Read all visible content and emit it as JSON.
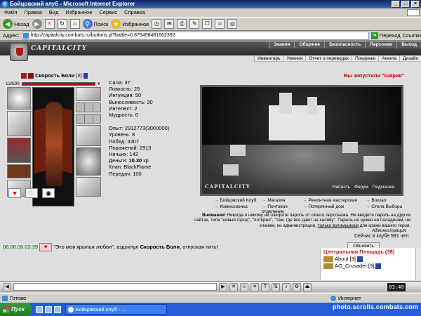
{
  "window": {
    "title": "Бойцовский клуб - Microsoft Internet Explorer"
  },
  "menu": [
    "Файл",
    "Правка",
    "Вид",
    "Избранное",
    "Сервис",
    "Справка"
  ],
  "toolbar": {
    "back": "Назад",
    "search": "Поиск",
    "favorites": "Избранное"
  },
  "address": {
    "label": "Адрес:",
    "url": "http://capitalcity.combats.ru/buttons.pl?battle=0.876498481662392",
    "go": "Переход",
    "links": "Ссылки"
  },
  "site": {
    "logo": "CAPITALCITY",
    "nav": [
      "Знания",
      "Общение",
      "Безопасность",
      "Персонаж",
      "Выход"
    ],
    "subnav": [
      "Инвентарь",
      "Умения",
      "Отчет о переводах",
      "Поединки",
      "Анкета",
      "Дизайн"
    ]
  },
  "character": {
    "name": "Скорость Боли",
    "level": "[8]",
    "hp": "13/599",
    "stats": [
      "Сила: 37",
      "Ловкость: 25",
      "Интуиция: 50",
      "Выносливость: 30",
      "Интелект: 2",
      "Мудрость: 0"
    ],
    "info": [
      "Опыт: 2912773(3000000)",
      "Уровень: 8",
      "Побед: 3307",
      "Поражений: 2913",
      "Ничьих: 142"
    ],
    "money_label": "Деньги: ",
    "money_value": "10.30",
    "money_unit": " кр.",
    "clan": "Клан: BlackFlame",
    "transfers": "Передач: 100"
  },
  "notice": "Вы запустили \"Шарик\"",
  "scene": {
    "title": "CAPITALCITY",
    "links": [
      "Напасть",
      "Форум",
      "Подсказка"
    ]
  },
  "locations": [
    "Бойцовский Клуб",
    "Магазин",
    "Ремонтная мастерская",
    "Вокзал",
    "Комиссионка",
    "Почтовое отделение",
    "Потерянный дом",
    "Стела Выбора"
  ],
  "warning": {
    "strong": "Внимание!",
    "text": " Никогда и никому не говорите пароль от своего персонажа. Не вводите пароль на других сайтах, типа \"новый город\", \"лотерея\", \"там, где все дают на халяву\". Пароль не нужен ни паладинам, ни кланам, ни администрации, ",
    "underline": "только взломщикам",
    "tail": " для кражи вашего героя.",
    "admin": "Администрация.",
    "online": "Сейчас в клубе 591 чел."
  },
  "chat": {
    "time": "08.08.06 03:39",
    "before": " \"Это мои крылья любви\", вздохнул ",
    "who": "Скорость Боли",
    "after": ", отпуская нить!"
  },
  "room": {
    "refresh": "Обновить",
    "title": "Центральная Площадь (38)",
    "users": [
      {
        "name": "About",
        "level": "[9]"
      },
      {
        "name": "AG_Crusader",
        "level": "[9]"
      }
    ]
  },
  "gamebar": {
    "clock": "03:40"
  },
  "status": {
    "ready": "Готово",
    "zone": "Интернет"
  },
  "taskbar": {
    "start": "Пуск",
    "task": "Бойцовский клуб - ..."
  },
  "watermark": "photo.scrolls.combats.com"
}
